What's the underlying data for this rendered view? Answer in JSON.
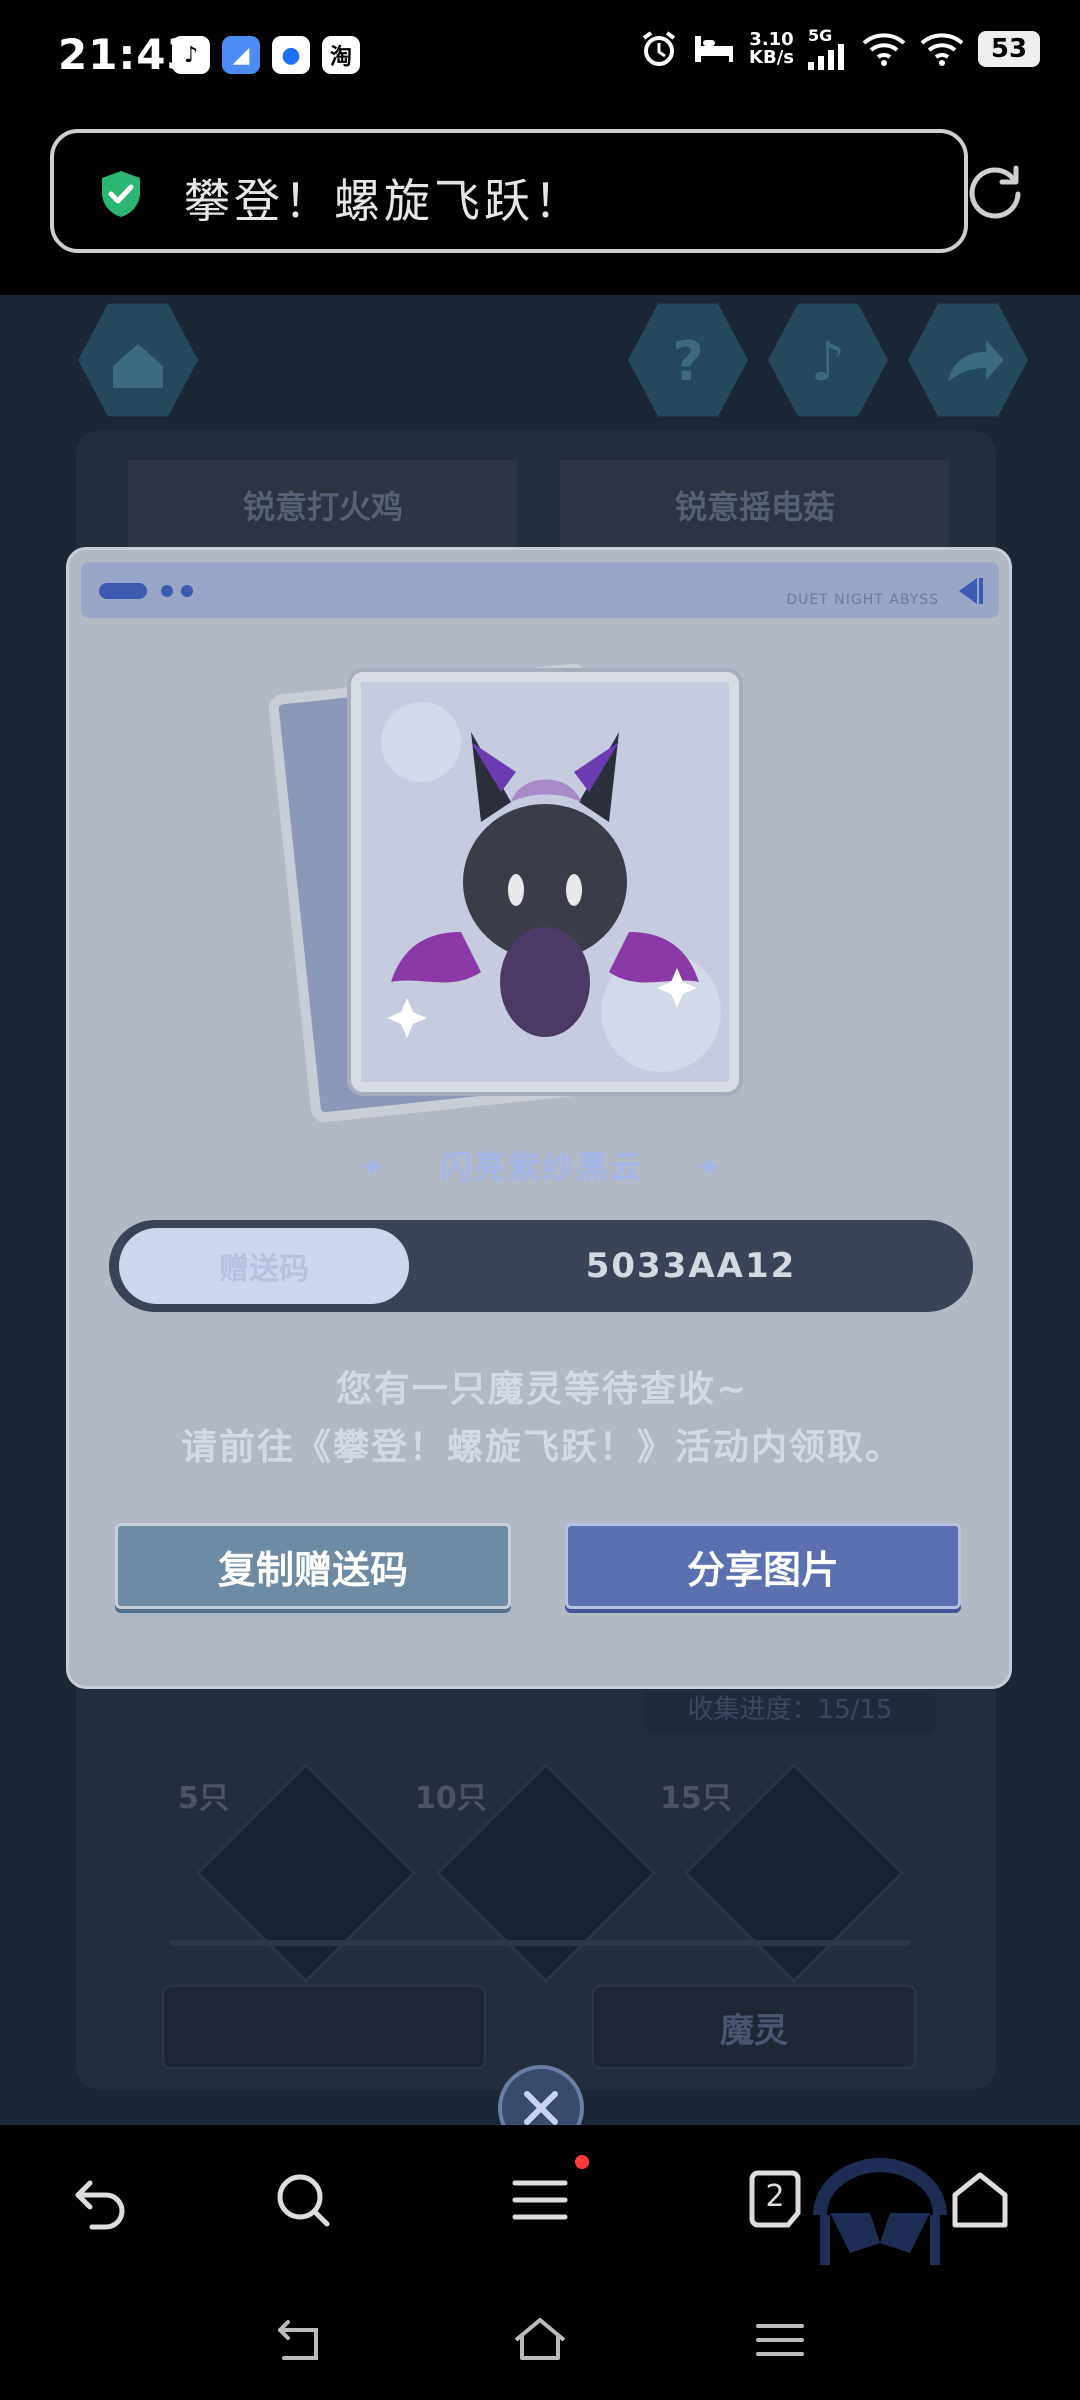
{
  "status_bar": {
    "time": "21:43",
    "app_icons": [
      "tiktok-icon",
      "cloud-app-icon",
      "message-app-icon",
      "taobao-icon"
    ],
    "taobao_label": "淘",
    "speed_value": "3.10",
    "speed_unit": "KB/s",
    "network": "5G",
    "battery": "53"
  },
  "url_bar": {
    "title": "攀登！螺旋飞跃！"
  },
  "game_bg": {
    "tab_left": "锐意打火鸡",
    "tab_right": "锐意摇电菇",
    "progress_note": "收集进度：15/15",
    "milestones": [
      "5只",
      "10只",
      "15只"
    ],
    "bottom_left_button": "",
    "bottom_right_button": "魔灵"
  },
  "dialog": {
    "brand": "DUET NIGHT ABYSS",
    "pet_name": "闪亮紫纱黑云",
    "code_toggle_label": "赠送码",
    "gift_code": "5033AA12",
    "message_line1": "您有一只魔灵等待查收~",
    "message_line2": "请前往《攀登！螺旋飞跃！》活动内领取。",
    "copy_button": "复制赠送码",
    "share_button": "分享图片"
  },
  "browser_nav": {
    "tab_count": "2"
  },
  "colors": {
    "dialog_bg": "#b3b9c4",
    "copy_button": "#6f8ba3",
    "share_button": "#5c6fb0",
    "shield": "#2bb673"
  }
}
